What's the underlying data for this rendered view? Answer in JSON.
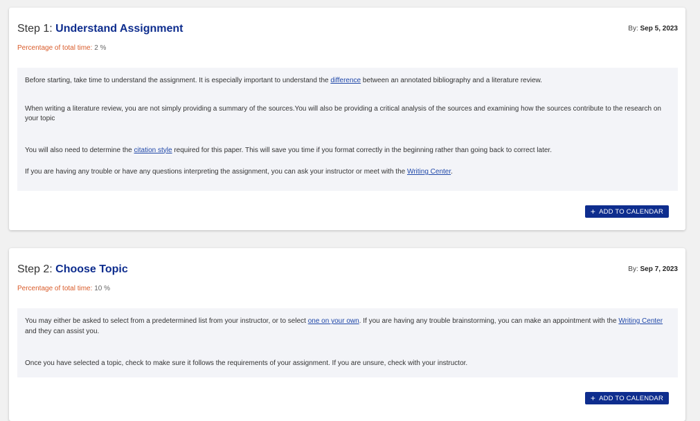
{
  "steps": [
    {
      "prefix": "Step 1:",
      "name": "Understand Assignment",
      "by_label": "By:",
      "date": "Sep 5, 2023",
      "pct_label": "Percentage of total time:",
      "pct_value": "2 %",
      "p1_a": "Before starting, take time to understand the assignment. It is especially important to understand the ",
      "p1_link": "difference",
      "p1_b": " between an annotated bibliography and a literature review.",
      "p2": "When writing a literature review, you are not simply providing a summary of the sources.You will also be providing a critical analysis of the sources and examining how the sources contribute to the research on your topic",
      "p3_a": "You will also need to determine the ",
      "p3_link": "citation style",
      "p3_b": " required for this paper. This will save you time if you format correctly in the beginning rather than going back to correct later.",
      "p4_a": "If you are having any trouble or have any questions interpreting the assignment, you can ask your instructor or meet with the ",
      "p4_link": "Writing Center",
      "p4_b": ".",
      "button": "ADD TO CALENDAR"
    },
    {
      "prefix": "Step 2:",
      "name": "Choose Topic",
      "by_label": "By:",
      "date": "Sep 7, 2023",
      "pct_label": "Percentage of total time:",
      "pct_value": "10 %",
      "p1_a": "You may either be asked to select from a predetermined list from your instructor, or to select ",
      "p1_link": "one on your own",
      "p1_b": ". If you are having any trouble brainstorming, you can make an appointment with the ",
      "p1_link2": "Writing Center",
      "p1_c": " and they can assist you.",
      "p2": "Once you have selected a topic, check to make sure it follows the requirements of your assignment. If you are unsure, check with your instructor.",
      "button": "ADD TO CALENDAR"
    }
  ],
  "colors": {
    "title": "#0e2d8e",
    "pct_label": "#d95b2a",
    "button_bg": "#0e2d8e",
    "content_bg": "#f3f4f8",
    "link": "#1f47a8"
  },
  "icons": {
    "add": "plus-icon"
  }
}
